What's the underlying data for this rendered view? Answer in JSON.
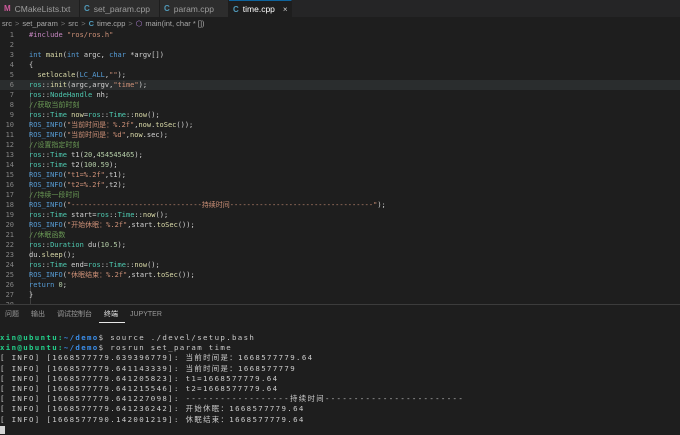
{
  "tabs": [
    {
      "icon": "M",
      "label": "CMakeLists.txt",
      "icon_color": "#ce5a9c",
      "active": false
    },
    {
      "icon": "C",
      "label": "set_param.cpp",
      "icon_color": "#519aba",
      "active": false
    },
    {
      "icon": "C",
      "label": "param.cpp",
      "icon_color": "#519aba",
      "active": false
    },
    {
      "icon": "C",
      "label": "time.cpp",
      "icon_color": "#519aba",
      "active": true,
      "close": "×"
    }
  ],
  "breadcrumbs": [
    "src",
    "set_param",
    "src",
    "time.cpp",
    "main(int, char * [])"
  ],
  "breadcrumb_sep": ">",
  "code_lines": [
    "#include \"ros/ros.h\"",
    "",
    "int main(int argc, char *argv[])",
    "{",
    "  setlocale(LC_ALL,\"\");",
    "ros::init(argc,argv,\"time\");",
    "ros::NodeHandle nh;",
    "//获取当前时刻",
    "ros::Time now=ros::Time::now();",
    "ROS_INFO(\"当前时间是：%.2f\",now.toSec());",
    "ROS_INFO(\"当前时间是：%d\",now.sec);",
    "//设置指定时刻",
    "ros::Time t1(20,454545465);",
    "ros::Time t2(100.59);",
    "ROS_INFO(\"t1=%.2f\",t1);",
    "ROS_INFO(\"t2=%.2f\",t2);",
    "//持续一段时间",
    "ROS_INFO(\"-------------------------------持续时间----------------------------------\");",
    "ros::Time start=ros::Time::now();",
    "ROS_INFO(\"开始休眠：%.2f\",start.toSec());",
    "//休眠函数",
    "ros::Duration du(10.5);",
    "du.sleep();",
    "ros::Time end=ros::Time::now();",
    "ROS_INFO(\"休眠结束：%.2f\",start.toSec());",
    "return 0;",
    "}",
    ""
  ],
  "panel_tabs": [
    "问题",
    "输出",
    "调试控制台",
    "终端",
    "JUPYTER"
  ],
  "active_panel_tab": "终端",
  "terminal": {
    "lines": [
      {
        "prompt": "xin@ubuntu:",
        "path": "~/demo",
        "cmd": "$ source ./devel/setup.bash"
      },
      {
        "prompt": "xin@ubuntu:",
        "path": "~/demo",
        "cmd": "$ rosrun set_param time"
      },
      {
        "text": "[ INFO] [1668577779.639396779]: 当前时间是：1668577779.64"
      },
      {
        "text": "[ INFO] [1668577779.641143339]: 当前时间是：1668577779"
      },
      {
        "text": "[ INFO] [1668577779.641205823]: t1=1668577779.64"
      },
      {
        "text": "[ INFO] [1668577779.641215546]: t2=1668577779.64"
      },
      {
        "text": "[ INFO] [1668577779.641227098]: ------------------持续时间------------------------"
      },
      {
        "text": "[ INFO] [1668577779.641236242]: 开始休眠：1668577779.64"
      },
      {
        "text": "[ INFO] [1668577790.142001219]: 休眠结束：1668577779.64"
      }
    ]
  },
  "colors": {
    "keyword": "#569cd6",
    "type": "#4ec9b0",
    "string": "#ce9178",
    "comment": "#6a9955",
    "function": "#dcdcaa",
    "number": "#b5cea8",
    "macro": "#c586c0",
    "prompt": "#23d18b",
    "path": "#3b8eea"
  }
}
